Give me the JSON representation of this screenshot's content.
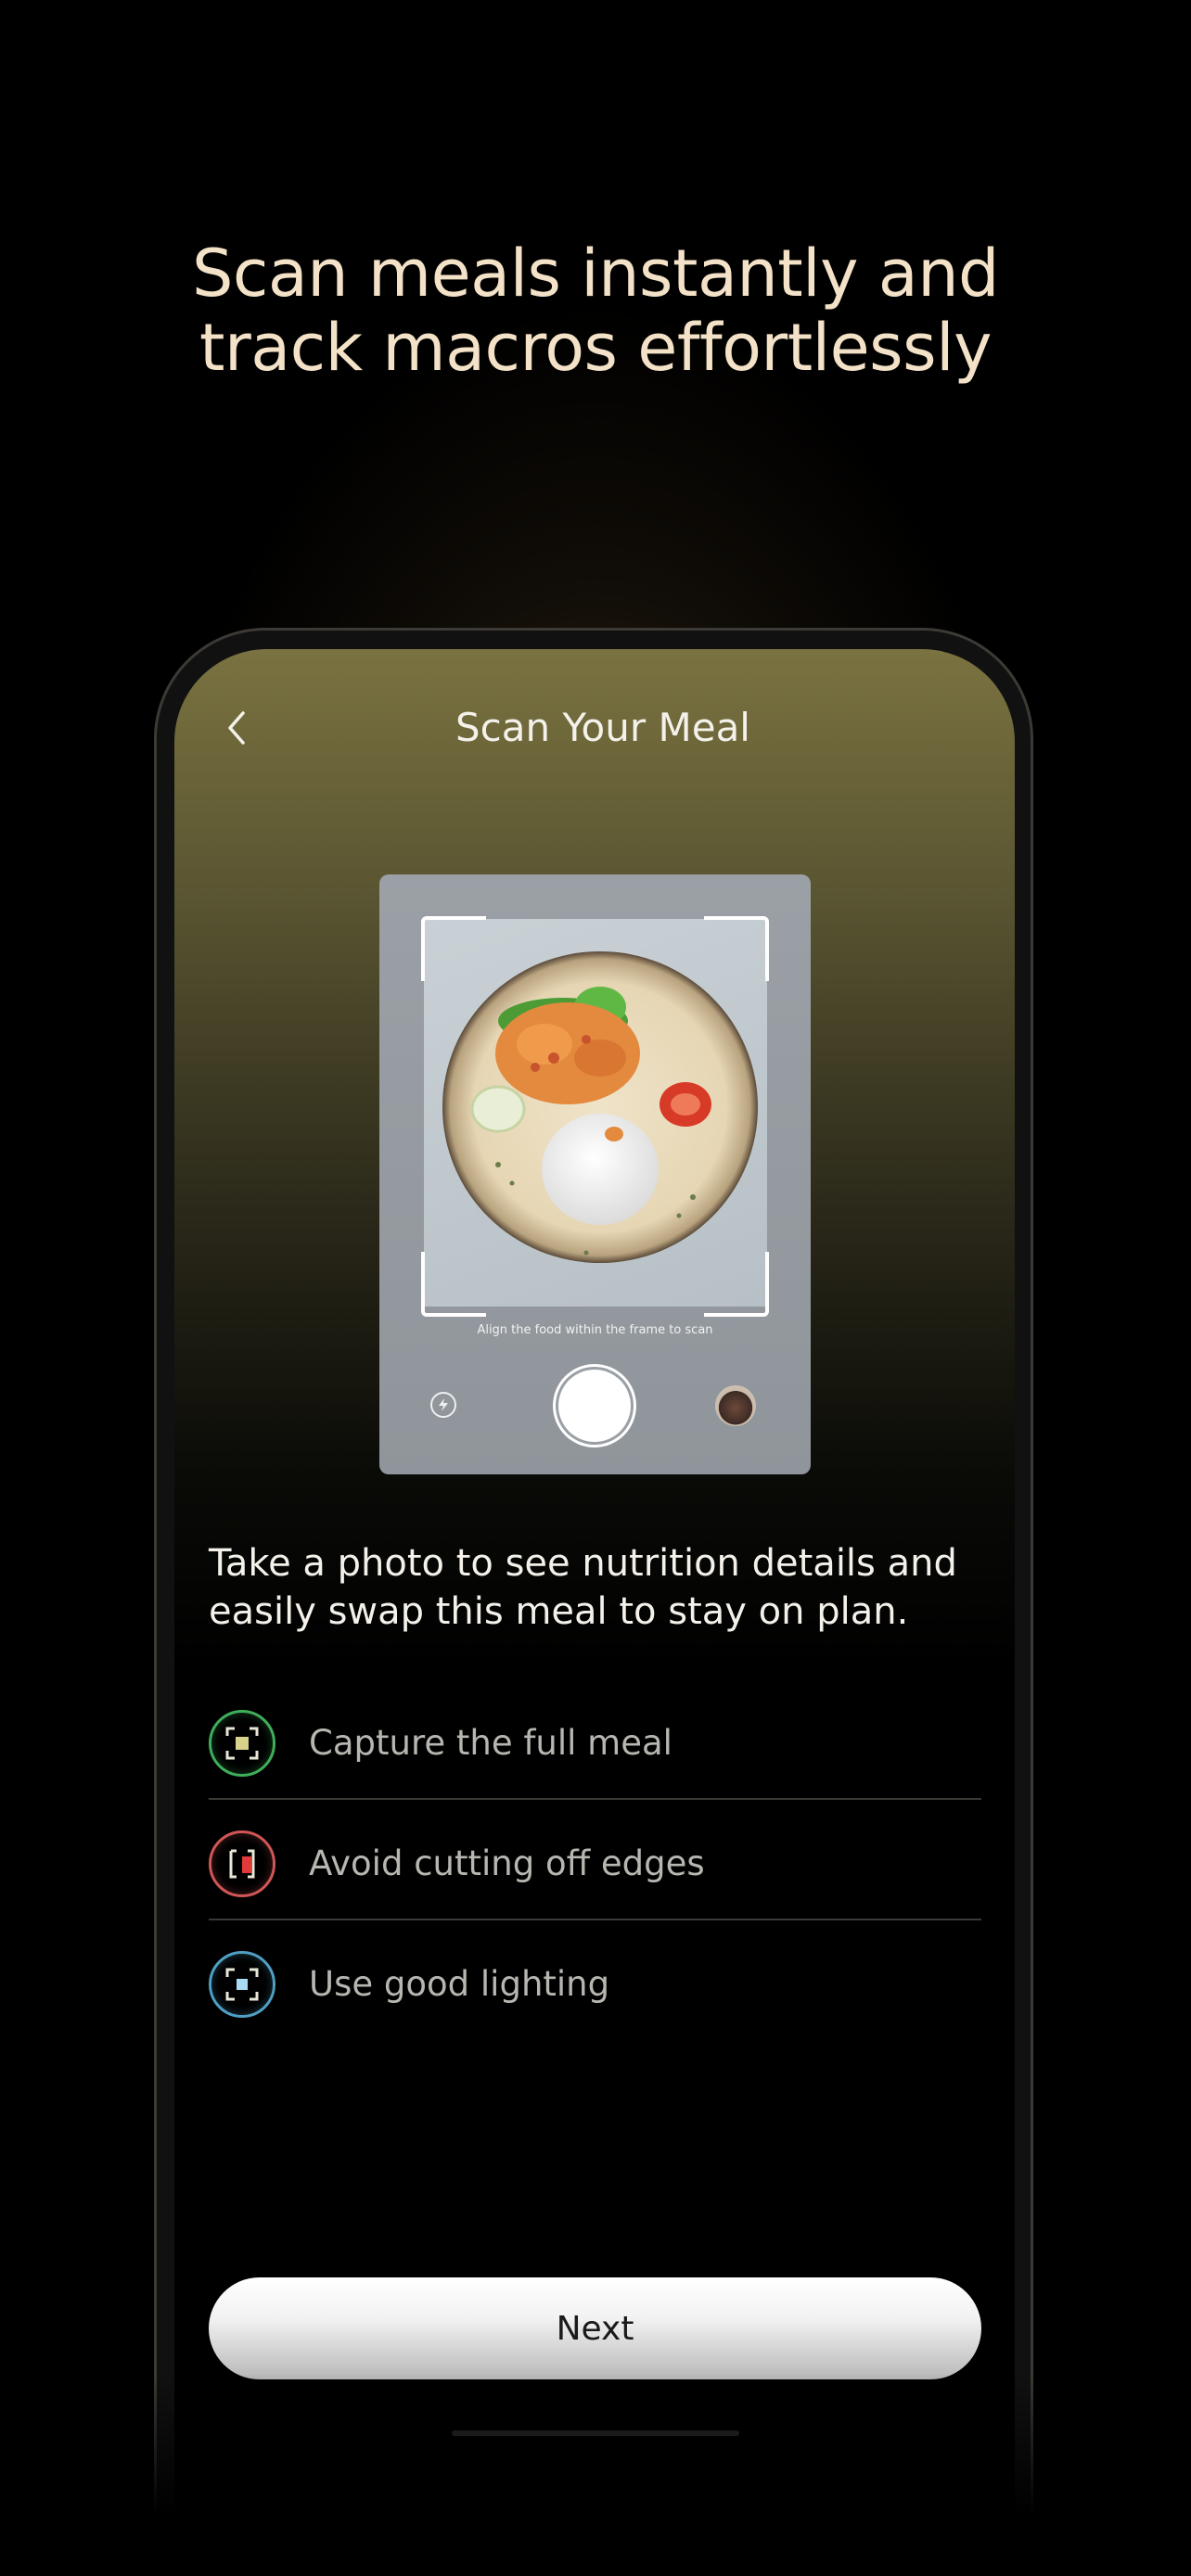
{
  "headline": {
    "line1": "Scan meals instantly and",
    "line2": "track macros effortlessly"
  },
  "screen": {
    "title": "Scan Your Meal",
    "back_icon": "chevron-left-icon"
  },
  "camera": {
    "hint": "Align the food within the frame to scan",
    "flash_icon": "flash-icon",
    "shutter_icon": "shutter-icon",
    "gallery_icon": "gallery-thumbnail"
  },
  "description": "Take a photo to see nutrition details and easily swap this meal to stay on plan.",
  "tips": [
    {
      "label": "Capture the full meal",
      "icon": "frame-full-icon",
      "color": "#3fae5a"
    },
    {
      "label": "Avoid cutting off edges",
      "icon": "frame-cut-icon",
      "color": "#d05656"
    },
    {
      "label": "Use good lighting",
      "icon": "frame-light-icon",
      "color": "#4f9fc4"
    }
  ],
  "next_button": {
    "label": "Next"
  }
}
